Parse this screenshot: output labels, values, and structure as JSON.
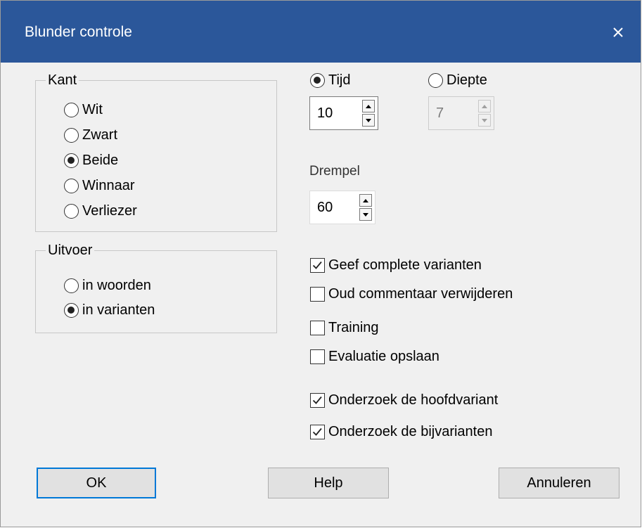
{
  "window": {
    "title": "Blunder controle"
  },
  "side_group": {
    "label": "Kant",
    "options": [
      {
        "label": "Wit",
        "selected": false
      },
      {
        "label": "Zwart",
        "selected": false
      },
      {
        "label": "Beide",
        "selected": true
      },
      {
        "label": "Winnaar",
        "selected": false
      },
      {
        "label": "Verliezer",
        "selected": false
      }
    ]
  },
  "output_group": {
    "label": "Uitvoer",
    "options": [
      {
        "label": "in woorden",
        "selected": false
      },
      {
        "label": "in varianten",
        "selected": true
      }
    ]
  },
  "mode": {
    "time": {
      "label": "Tijd",
      "selected": true,
      "value": "10"
    },
    "depth": {
      "label": "Diepte",
      "selected": false,
      "value": "7",
      "enabled": false
    }
  },
  "threshold": {
    "label": "Drempel",
    "value": "60"
  },
  "options": [
    {
      "label": "Geef complete varianten",
      "checked": true
    },
    {
      "label": "Oud commentaar verwijderen",
      "checked": false
    },
    {
      "label": "Training",
      "checked": false
    },
    {
      "label": "Evaluatie opslaan",
      "checked": false
    },
    {
      "label": "Onderzoek de hoofdvariant",
      "checked": true
    },
    {
      "label": "Onderzoek de bijvarianten",
      "checked": true
    }
  ],
  "buttons": {
    "ok": "OK",
    "help": "Help",
    "cancel": "Annuleren"
  },
  "colors": {
    "titlebar": "#2b579a",
    "dialog_bg": "#f0f0f0",
    "default_button_border": "#0078d7"
  }
}
